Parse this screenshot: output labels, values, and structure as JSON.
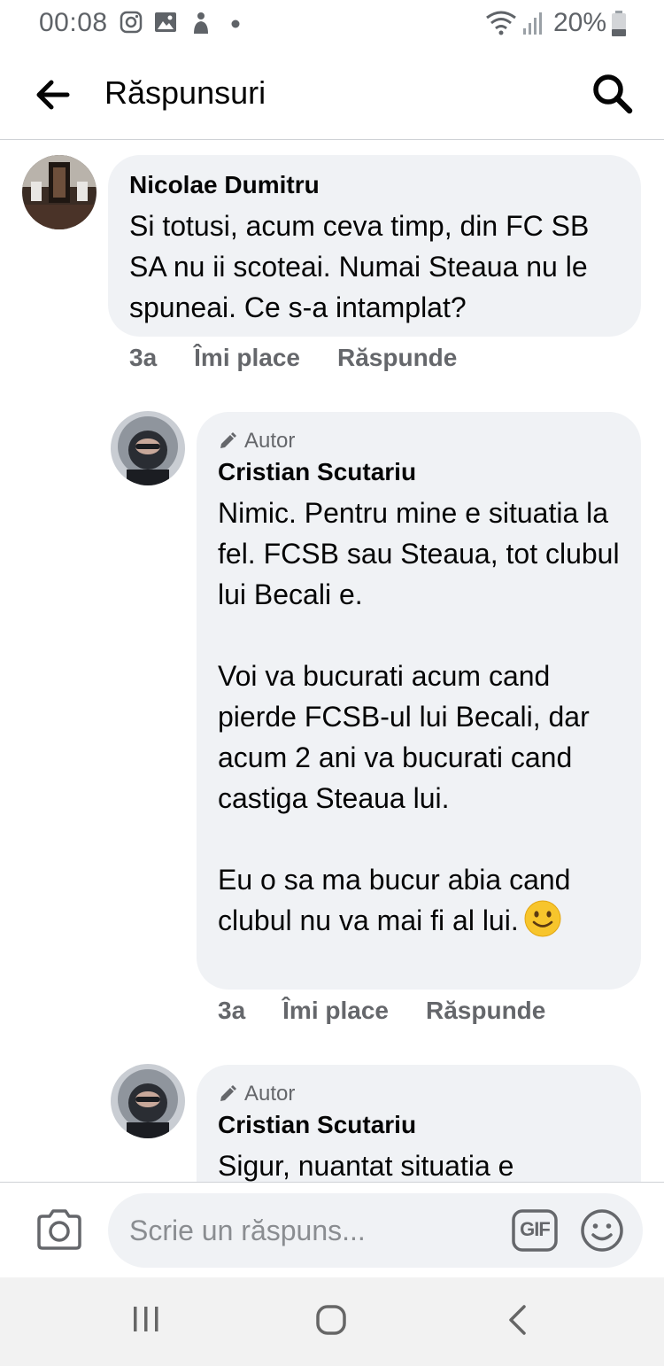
{
  "status_bar": {
    "time": "00:08",
    "battery": "20%",
    "icons": [
      "instagram-icon",
      "gallery-icon",
      "notification-icon",
      "dot-icon",
      "wifi-icon",
      "signal-icon",
      "battery-icon"
    ]
  },
  "header": {
    "title": "Răspunsuri",
    "back_icon": "back-arrow-icon",
    "search_icon": "search-icon"
  },
  "comments": [
    {
      "author": "Nicolae Dumitru",
      "text": "Si totusi, acum ceva timp, din FC SB SA nu ii scoteai. Numai Steaua nu le spuneai. Ce s-a intamplat?",
      "time": "3a",
      "like": "Îmi place",
      "reply": "Răspunde"
    },
    {
      "badge": "Autor",
      "author": "Cristian Scutariu",
      "text": "Nimic. Pentru mine e situatia la fel. FCSB sau Steaua, tot clubul lui Becali e.\n\nVoi va bucurati acum cand pierde FCSB-ul lui Becali, dar acum 2 ani va bucurati cand castiga Steaua lui.\n\nEu o sa ma bucur abia cand clubul nu va mai fi al lui.",
      "time": "3a",
      "like": "Îmi place",
      "reply": "Răspunde"
    },
    {
      "badge": "Autor",
      "author": "Cristian Scutariu",
      "text": "Sigur, nuantat situatia e"
    }
  ],
  "composer": {
    "placeholder": "Scrie un răspuns...",
    "gif_label": "GIF"
  },
  "colors": {
    "bubble": "#f0f2f5",
    "secondary_text": "#65676b",
    "primary_text": "#050505"
  }
}
